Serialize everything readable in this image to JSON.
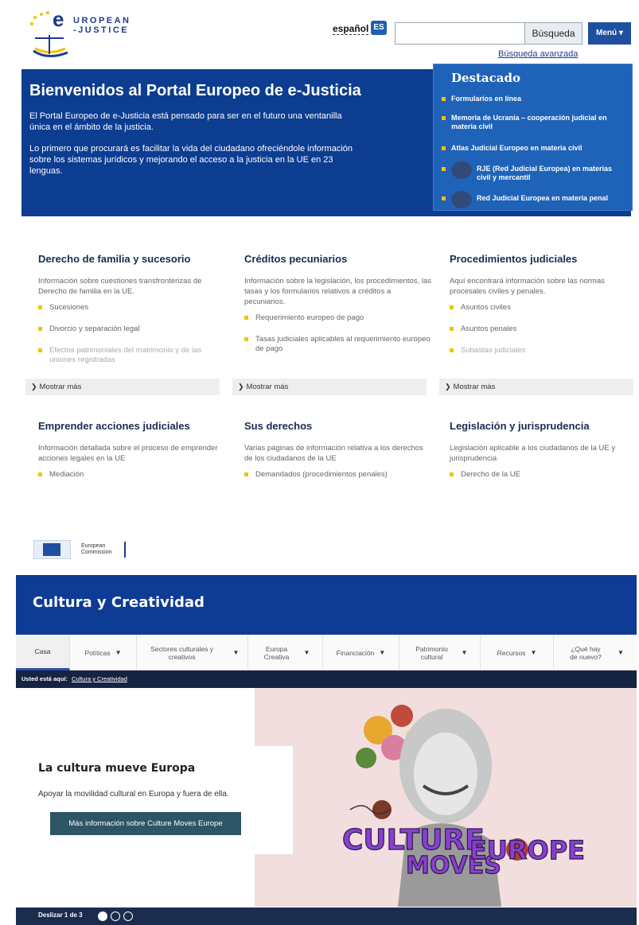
{
  "ejustice": {
    "logo_line1": "UROPEAN",
    "logo_line2": "-JUSTICE",
    "logo_initial": "e",
    "language_label": "español",
    "language_code": "ES",
    "search_button": "Búsqueda",
    "menu_button": "Menú",
    "advanced_search": "Búsqueda avanzada",
    "hero_title": "Bienvenidos al Portal Europeo de e-Justicia",
    "hero_p1": "El Portal Europeo de e-Justicia está pensado para ser en el futuro una ventanilla única en el ámbito de la justicia.",
    "hero_p2": "Lo primero que procurará es facilitar la vida del ciudadano ofreciéndole información sobre los sistemas jurídicos y mejorando el acceso a la justicia en la UE en 23 lenguas.",
    "featured_title": "Destacado",
    "featured_items": [
      "Formularios en línea",
      "Memoria de Ucrania – cooperación judicial en materia civil",
      "Atlas Judicial Europeo en materia civil",
      "RJE (Red Judicial Europea) en materias civil y mercantil",
      "Red Judicial Europea en materia penal"
    ],
    "columns": [
      {
        "title": "Derecho de familia y sucesorio",
        "desc": "Información sobre cuestiones transfronterizas de Derecho de familia en la UE.",
        "items": [
          "Sucesiones",
          "Divorcio y separación legal",
          "Efectos patrimoniales del matrimonio y de las uniones registradas"
        ]
      },
      {
        "title": "Créditos pecuniarios",
        "desc": "Información sobre la legislación, los procedimientos, las tasas y los formularios relativos a créditos a pecuniarios.",
        "items": [
          "Requerimiento europeo de pago",
          "Tasas judiciales aplicables al requerimiento europeo de pago"
        ]
      },
      {
        "title": "Procedimientos judiciales",
        "desc": "Aquí encontrará información sobre las normas procesales civiles y penales.",
        "items": [
          "Asuntos civiles",
          "Asuntos penales",
          "Subastas judiciales"
        ]
      },
      {
        "title": "Emprender acciones judiciales",
        "desc": "Información detallada sobre el proceso de emprender acciones legales en la UE",
        "items": [
          "Mediación"
        ]
      },
      {
        "title": "Sus derechos",
        "desc": "Varias páginas de información relativa a los derechos de los ciudadanos de la UE",
        "items": [
          "Demandados (procedimientos penales)"
        ]
      },
      {
        "title": "Legislación y jurisprudencia",
        "desc": "Legislación aplicable a los ciudadanos de la UE y jurisprudencia",
        "items": [
          "Derecho de la UE"
        ]
      }
    ],
    "show_more": "Mostrar más"
  },
  "cultura": {
    "ec_logo_line1": "European",
    "ec_logo_line2": "Commission",
    "site_title": "Cultura y Creatividad",
    "nav": [
      {
        "label": "Casa",
        "caret": false
      },
      {
        "label": "Políticas",
        "caret": true
      },
      {
        "label": "Sectores culturales y creativos",
        "caret": true
      },
      {
        "label": "Europa Creativa",
        "caret": true
      },
      {
        "label": "Financiación",
        "caret": true
      },
      {
        "label": "Patrimonio cultural",
        "caret": true
      },
      {
        "label": "Recursos",
        "caret": true
      },
      {
        "label": "¿Qué hay de nuevo?",
        "caret": true
      }
    ],
    "breadcrumb_label": "Usted está aquí:",
    "breadcrumb_link": "Cultura y Creatividad",
    "slide_title": "La cultura mueve Europa",
    "slide_text": "Apoyar la movilidad cultural en Europa y fuera de ella.",
    "slide_cta": "Más información sobre Culture Moves Europe",
    "poster_line1": "CULTURE",
    "poster_line2": "MOVES",
    "poster_line3": "EUROPE",
    "slider_label": "Deslizar 1 de 3"
  },
  "colors": {
    "ej_blue": "#0c3d91",
    "featured_blue": "#1f63b8",
    "bullet_yellow": "#f2c200",
    "cc_blue": "#0e3b94",
    "cc_dark": "#152442",
    "cta_teal": "#2d5566",
    "poster_bg": "#f2dede",
    "poster_purple": "#8a3fd1"
  }
}
